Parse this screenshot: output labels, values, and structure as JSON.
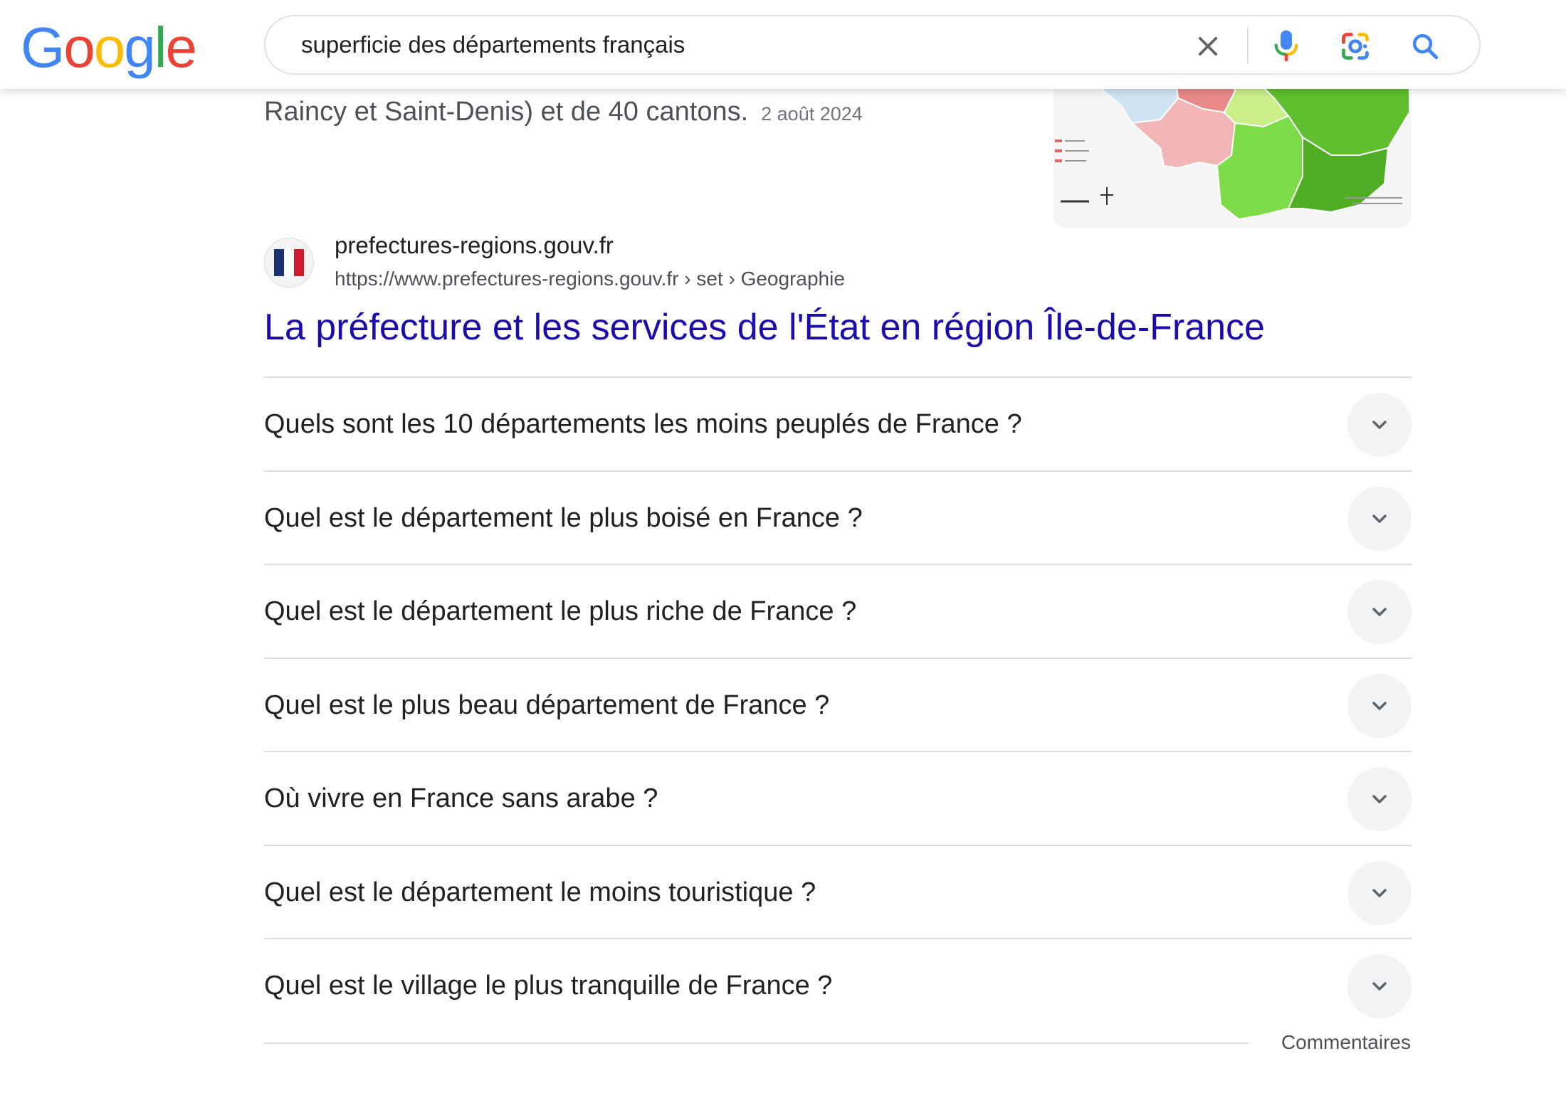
{
  "header": {
    "logo_text": "Google",
    "logo_colors": [
      "#4285F4",
      "#EA4335",
      "#FBBC05",
      "#4285F4",
      "#34A853",
      "#EA4335"
    ],
    "search_query": "superficie des départements français",
    "icons": {
      "clear": "close-icon",
      "voice": "microphone-icon",
      "lens": "google-lens-icon",
      "search": "search-icon"
    }
  },
  "snippet": {
    "text": "Raincy et Saint-Denis) et de 40 cantons.",
    "date": "2 août 2024"
  },
  "result": {
    "site_name": "prefectures-regions.gouv.fr",
    "breadcrumb": "https://www.prefectures-regions.gouv.fr › set › Geographie",
    "title": "La préfecture et les services de l'État en région Île-de-France",
    "favicon": "marianne-flag-icon"
  },
  "people_also_ask": [
    {
      "question": "Quels sont les 10 départements les moins peuplés de France ?"
    },
    {
      "question": "Quel est le département le plus boisé en France ?"
    },
    {
      "question": "Quel est le département le plus riche de France ?"
    },
    {
      "question": "Quel est le plus beau département de France ?"
    },
    {
      "question": "Où vivre en France sans arabe ?"
    },
    {
      "question": "Quel est le département le moins touristique ?"
    },
    {
      "question": "Quel est le village le plus tranquille de France ?"
    }
  ],
  "feedback_label": "Commentaires",
  "colors": {
    "link": "#1a0dab",
    "text": "#202124",
    "secondary_text": "#4d5156",
    "divider": "#dadce0"
  }
}
